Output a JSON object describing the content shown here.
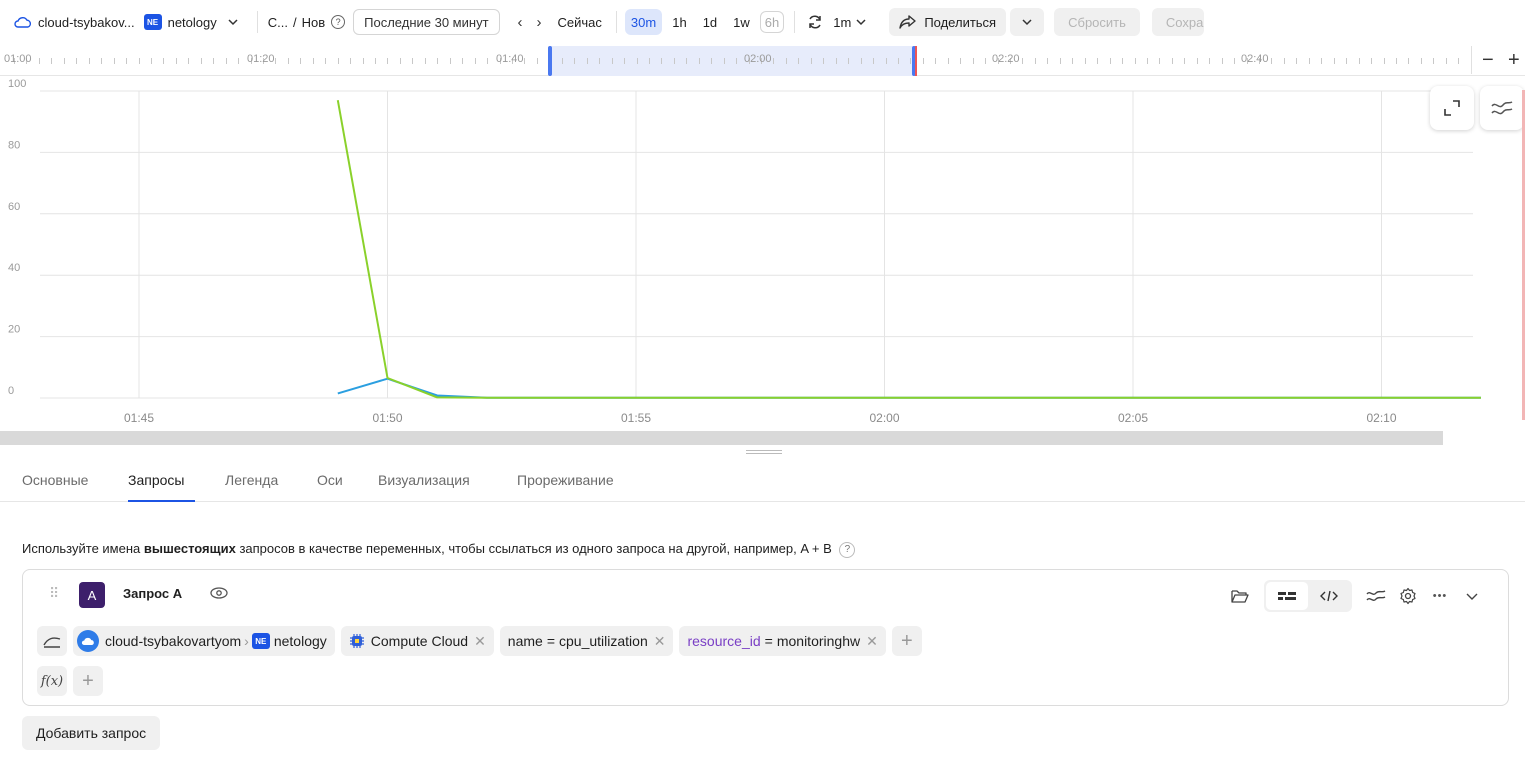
{
  "toolbar": {
    "folder_name": "cloud-tsybakov...",
    "folder_badge": "NE",
    "project_name": "netology",
    "breadcrumb_first": "С...",
    "breadcrumb_sep": "/",
    "breadcrumb_second": "Нов",
    "help_label": "?",
    "time_range": "Последние 30 минут",
    "prev_arrow": "‹",
    "next_arrow": "›",
    "now_label": "Сейчас",
    "zoom_options": [
      "30m",
      "1h",
      "1d",
      "1w",
      "6h"
    ],
    "zoom_active": "30m",
    "refresh_interval": "1m",
    "share_label": "Поделиться",
    "reset_label": "Сбросить",
    "save_label": "Сохра"
  },
  "ruler": {
    "labels": [
      "01:00",
      "01:20",
      "01:40",
      "02:00",
      "02:20",
      "02:40"
    ],
    "zoom_out": "−",
    "zoom_in": "+"
  },
  "chart_data": {
    "type": "line",
    "x": [
      "01:49",
      "01:50",
      "01:51",
      "01:52",
      "01:53",
      "01:54",
      "01:55",
      "01:56",
      "01:57",
      "01:58",
      "01:59",
      "02:00",
      "02:01",
      "02:02",
      "02:03",
      "02:04",
      "02:05",
      "02:06",
      "02:07",
      "02:08",
      "02:09",
      "02:10",
      "02:11",
      "02:12"
    ],
    "x_tick_labels": [
      "01:45",
      "01:50",
      "01:55",
      "02:00",
      "02:05",
      "02:10"
    ],
    "series": [
      {
        "color": "#8ad12b",
        "values": [
          97,
          6.5,
          0.2,
          0.1,
          0.1,
          0.1,
          0.1,
          0.1,
          0.1,
          0.1,
          0.1,
          0.1,
          0.1,
          0.1,
          0.1,
          0.1,
          0.1,
          0.1,
          0.1,
          0.1,
          0.1,
          0.1,
          0.1,
          0.1
        ]
      },
      {
        "color": "#2b9fe0",
        "values": [
          1.5,
          6.3,
          0.8,
          0.1,
          0.1,
          0.1,
          0.1,
          0.1,
          0.1,
          0.1,
          0.1,
          0.1,
          0.1,
          0.1,
          0.1,
          0.1,
          0.1,
          0.1,
          0.1,
          0.1,
          0.1,
          0.1,
          0.1,
          0.1
        ]
      }
    ],
    "y_tick_labels": [
      "0",
      "20",
      "40",
      "60",
      "80",
      "100"
    ],
    "ylim": [
      0,
      100
    ],
    "grid": true
  },
  "tabs": [
    {
      "label": "Основные"
    },
    {
      "label": "Запросы"
    },
    {
      "label": "Легенда"
    },
    {
      "label": "Оси"
    },
    {
      "label": "Визуализация"
    },
    {
      "label": "Прореживание"
    }
  ],
  "active_tab": "Запросы",
  "hint": {
    "before": "Используйте имена ",
    "bold": "вышестоящих",
    "after": " запросов в качестве переменных, чтобы ссылаться из одного запроса на другой, например, A + B",
    "help": "?"
  },
  "query": {
    "badge": "A",
    "title": "Запрос A",
    "folder_chip": "cloud-tsybakovartyom",
    "project_badge": "NE",
    "project_chip": "netology",
    "service_chip": "Compute Cloud",
    "label_name_key": "name",
    "label_name_op": "=",
    "label_name_value": "cpu_utilization",
    "label_resource_key": "resource_id",
    "label_resource_op": "=",
    "label_resource_value": "monitoringhw",
    "function_label": "f(x)",
    "plus": "+",
    "more": "•••"
  },
  "add_query_label": "Добавить запрос"
}
